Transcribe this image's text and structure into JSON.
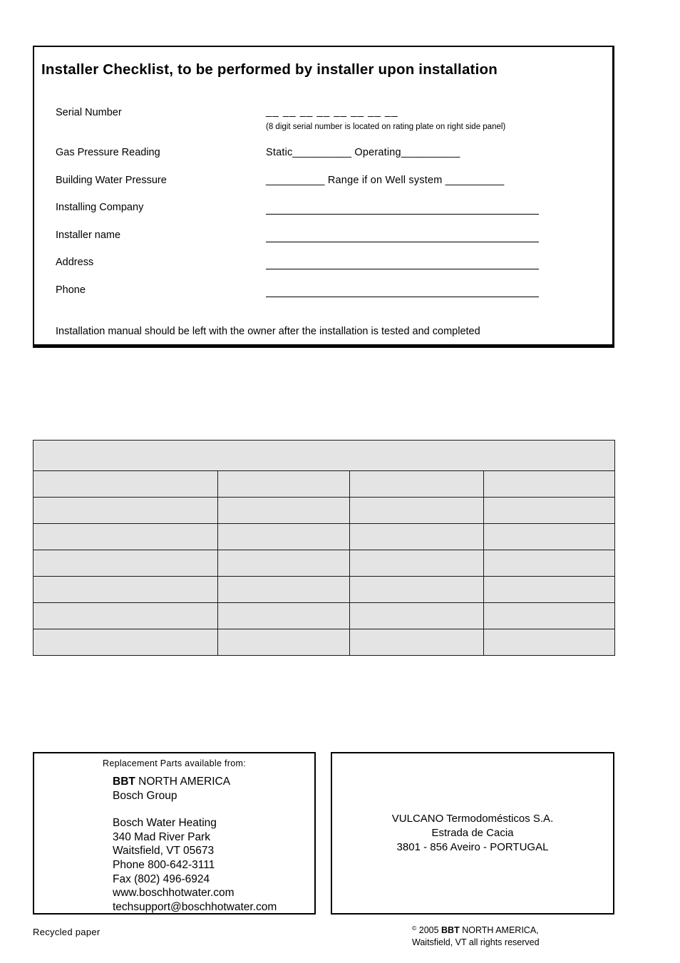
{
  "checklist": {
    "title": "Installer Checklist, to be performed by installer upon installation",
    "rows": [
      {
        "label": "Serial Number",
        "type": "serial",
        "dashes": "__  __  __  __  __  __  __  __",
        "note": "(8 digit serial number is located on rating plate on right side panel)"
      },
      {
        "label": "Gas Pressure Reading",
        "type": "text",
        "value": "Static__________  Operating__________"
      },
      {
        "label": "Building Water Pressure",
        "type": "text",
        "value": "__________ Range if on Well system __________"
      },
      {
        "label": "Installing Company",
        "type": "line"
      },
      {
        "label": "Installer name",
        "type": "line"
      },
      {
        "label": "Address",
        "type": "line"
      },
      {
        "label": "Phone",
        "type": "line"
      }
    ],
    "closing_note": "Installation manual should be left with the owner after the installation is tested and completed"
  },
  "data_table": {
    "columns": 4,
    "header_row": [
      "",
      "",
      "",
      ""
    ],
    "rows": [
      [
        "",
        "",
        "",
        ""
      ],
      [
        "",
        "",
        "",
        ""
      ],
      [
        "",
        "",
        "",
        ""
      ],
      [
        "",
        "",
        "",
        ""
      ],
      [
        "",
        "",
        "",
        ""
      ],
      [
        "",
        "",
        "",
        ""
      ],
      [
        "",
        "",
        "",
        ""
      ]
    ]
  },
  "parts_box": {
    "heading": "Replacement Parts available from:",
    "company_bold": "BBT",
    "company_rest": " NORTH AMERICA",
    "group": "Bosch Group",
    "address_lines": [
      "Bosch Water Heating",
      "340 Mad River Park",
      "Waitsfield, VT 05673",
      "Phone 800-642-3111",
      "Fax (802) 496-6924",
      "www.boschhotwater.com",
      "techsupport@boschhotwater.com"
    ]
  },
  "vulcano_box": {
    "lines": [
      "VULCANO Termodomésticos S.A.",
      "Estrada de Cacia",
      "3801 - 856 Aveiro - PORTUGAL"
    ]
  },
  "footer": {
    "recycled": "Recycled paper",
    "copyright_symbol": "©",
    "copyright_year": " 2005 ",
    "copyright_bold": "BBT",
    "copyright_rest": " NORTH AMERICA,",
    "copyright_line2": "Waitsfield, VT all rights reserved"
  },
  "colors": {
    "table_cell": "#e4e4e4",
    "border": "#1a1a1a",
    "text": "#000000",
    "page_background": "#ffffff"
  }
}
